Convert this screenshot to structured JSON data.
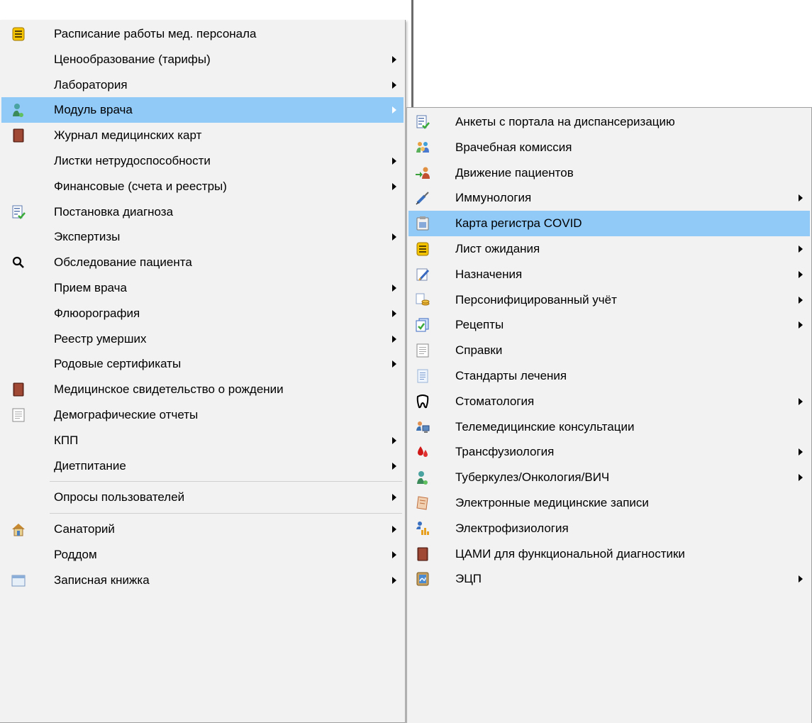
{
  "main_menu": {
    "items": [
      {
        "label": "Расписание работы мед. персонала",
        "icon": "list-icon",
        "submenu": false
      },
      {
        "label": "Ценообразование (тарифы)",
        "icon": "",
        "submenu": true
      },
      {
        "label": "Лаборатория",
        "icon": "",
        "submenu": true
      },
      {
        "label": "Модуль врача",
        "icon": "doctor-icon",
        "submenu": true,
        "highlighted": true
      },
      {
        "label": "Журнал медицинских карт",
        "icon": "book-icon",
        "submenu": false
      },
      {
        "label": "Листки нетрудоспособности",
        "icon": "",
        "submenu": true
      },
      {
        "label": "Финансовые (счета и реестры)",
        "icon": "",
        "submenu": true
      },
      {
        "label": "Постановка диагноза",
        "icon": "checklist-icon",
        "submenu": false
      },
      {
        "label": "Экспертизы",
        "icon": "",
        "submenu": true
      },
      {
        "label": "Обследование пациента",
        "icon": "search-icon",
        "submenu": false
      },
      {
        "label": "Прием врача",
        "icon": "",
        "submenu": true
      },
      {
        "label": "Флюорография",
        "icon": "",
        "submenu": true
      },
      {
        "label": "Реестр умерших",
        "icon": "",
        "submenu": true
      },
      {
        "label": "Родовые сертификаты",
        "icon": "",
        "submenu": true
      },
      {
        "label": "Медицинское свидетельство о рождении",
        "icon": "book-icon",
        "submenu": false
      },
      {
        "label": "Демографические отчеты",
        "icon": "document-icon",
        "submenu": false
      },
      {
        "label": "КПП",
        "icon": "",
        "submenu": true
      },
      {
        "label": "Диетпитание",
        "icon": "",
        "submenu": true
      },
      {
        "label": "Опросы пользователей",
        "icon": "",
        "submenu": true
      },
      {
        "label": "Санаторий",
        "icon": "house-icon",
        "submenu": true
      },
      {
        "label": "Роддом",
        "icon": "",
        "submenu": true
      },
      {
        "label": "Записная книжка",
        "icon": "window-icon",
        "submenu": true
      }
    ]
  },
  "sub_menu": {
    "items": [
      {
        "label": "Анкеты с портала на диспансеризацию",
        "icon": "checklist-icon",
        "submenu": false
      },
      {
        "label": "Врачебная комиссия",
        "icon": "group-icon",
        "submenu": false
      },
      {
        "label": "Движение пациентов",
        "icon": "patient-move-icon",
        "submenu": false
      },
      {
        "label": "Иммунология",
        "icon": "syringe-icon",
        "submenu": true
      },
      {
        "label": "Карта регистра COVID",
        "icon": "clipboard-icon",
        "submenu": false,
        "highlighted": true
      },
      {
        "label": "Лист ожидания",
        "icon": "list-icon",
        "submenu": true
      },
      {
        "label": "Назначения",
        "icon": "pen-icon",
        "submenu": true
      },
      {
        "label": "Персонифицированный учёт",
        "icon": "coins-icon",
        "submenu": true
      },
      {
        "label": "Рецепты",
        "icon": "prescription-icon",
        "submenu": true
      },
      {
        "label": "Справки",
        "icon": "document-icon",
        "submenu": false
      },
      {
        "label": "Стандарты лечения",
        "icon": "document-blue-icon",
        "submenu": false
      },
      {
        "label": "Стоматология",
        "icon": "tooth-icon",
        "submenu": true
      },
      {
        "label": "Телемедицинские консультации",
        "icon": "telemedicine-icon",
        "submenu": false
      },
      {
        "label": "Трансфузиология",
        "icon": "blood-drop-icon",
        "submenu": true
      },
      {
        "label": "Туберкулез/Онкология/ВИЧ",
        "icon": "doctor-icon",
        "submenu": true
      },
      {
        "label": "Электронные медицинские записи",
        "icon": "notepad-icon",
        "submenu": false
      },
      {
        "label": "Электрофизиология",
        "icon": "chart-person-icon",
        "submenu": false
      },
      {
        "label": "ЦАМИ для функциональной диагностики",
        "icon": "book-icon",
        "submenu": false
      },
      {
        "label": "ЭЦП",
        "icon": "signature-icon",
        "submenu": true
      }
    ]
  },
  "colors": {
    "highlight": "#91c9f7",
    "menu_bg": "#f2f2f2"
  }
}
